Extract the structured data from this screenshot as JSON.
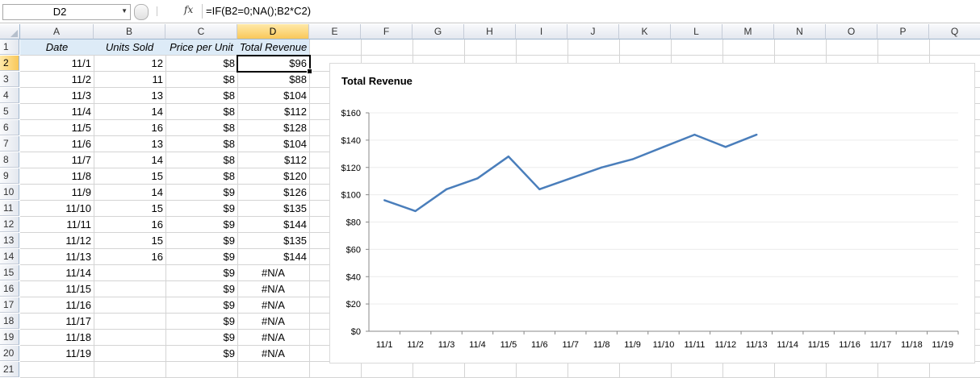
{
  "formula_bar": {
    "name_box": "D2",
    "fx_label": "fx",
    "formula": "=IF(B2=0;NA();B2*C2)"
  },
  "columns": [
    "A",
    "B",
    "C",
    "D",
    "E",
    "F",
    "G",
    "H",
    "I",
    "J",
    "K",
    "L",
    "M",
    "N",
    "O",
    "P",
    "Q"
  ],
  "selected_column": "D",
  "selected_row": 2,
  "row_numbers": [
    "1",
    "2",
    "3",
    "4",
    "5",
    "6",
    "7",
    "8",
    "9",
    "10",
    "11",
    "12",
    "13",
    "14",
    "15",
    "16",
    "17",
    "18",
    "19",
    "20",
    "21"
  ],
  "table": {
    "headers": [
      "Date",
      "Units Sold",
      "Price per Unit",
      "Total Revenue"
    ],
    "rows": [
      [
        "11/1",
        "12",
        "$8",
        "$96"
      ],
      [
        "11/2",
        "11",
        "$8",
        "$88"
      ],
      [
        "11/3",
        "13",
        "$8",
        "$104"
      ],
      [
        "11/4",
        "14",
        "$8",
        "$112"
      ],
      [
        "11/5",
        "16",
        "$8",
        "$128"
      ],
      [
        "11/6",
        "13",
        "$8",
        "$104"
      ],
      [
        "11/7",
        "14",
        "$8",
        "$112"
      ],
      [
        "11/8",
        "15",
        "$8",
        "$120"
      ],
      [
        "11/9",
        "14",
        "$9",
        "$126"
      ],
      [
        "11/10",
        "15",
        "$9",
        "$135"
      ],
      [
        "11/11",
        "16",
        "$9",
        "$144"
      ],
      [
        "11/12",
        "15",
        "$9",
        "$135"
      ],
      [
        "11/13",
        "16",
        "$9",
        "$144"
      ],
      [
        "11/14",
        "",
        "$9",
        "#N/A"
      ],
      [
        "11/15",
        "",
        "$9",
        "#N/A"
      ],
      [
        "11/16",
        "",
        "$9",
        "#N/A"
      ],
      [
        "11/17",
        "",
        "$9",
        "#N/A"
      ],
      [
        "11/18",
        "",
        "$9",
        "#N/A"
      ],
      [
        "11/19",
        "",
        "$9",
        "#N/A"
      ]
    ]
  },
  "chart_data": {
    "type": "line",
    "title": "Total Revenue",
    "categories": [
      "11/1",
      "11/2",
      "11/3",
      "11/4",
      "11/5",
      "11/6",
      "11/7",
      "11/8",
      "11/9",
      "11/10",
      "11/11",
      "11/12",
      "11/13",
      "11/14",
      "11/15",
      "11/16",
      "11/17",
      "11/18",
      "11/19"
    ],
    "series": [
      {
        "values": [
          96,
          88,
          104,
          112,
          128,
          104,
          112,
          120,
          126,
          135,
          144,
          135,
          144,
          null,
          null,
          null,
          null,
          null,
          null
        ]
      }
    ],
    "yticks": [
      "$0",
      "$20",
      "$40",
      "$60",
      "$80",
      "$100",
      "$120",
      "$140",
      "$160"
    ],
    "ylim": [
      0,
      160
    ],
    "grid": true,
    "legend": "none",
    "line_color": "#4a7ebb"
  }
}
